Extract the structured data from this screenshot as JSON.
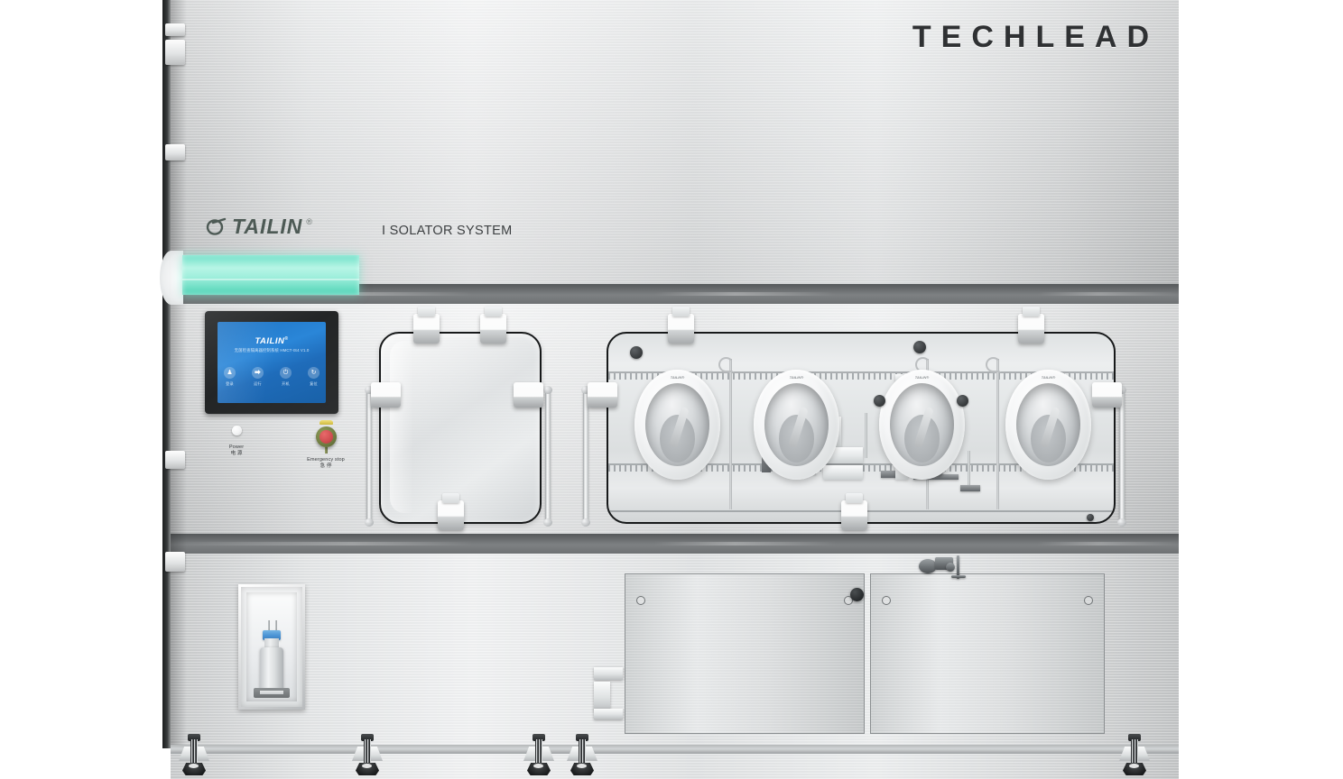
{
  "product": {
    "manufacturer_brand": "TECHLEAD",
    "oem_brand": "TAILIN",
    "registered_mark": "®",
    "system_label": "I SOLATOR SYSTEM"
  },
  "hmi": {
    "logo_text": "TAILIN",
    "logo_mark": "®",
    "subtitle": "无菌检查隔离器控制系统 HMCT-IS4 V1.0",
    "buttons": [
      {
        "label": "登录",
        "icon": "user-icon",
        "glyph": "♟"
      },
      {
        "label": "运行",
        "icon": "export-icon",
        "glyph": "⮕"
      },
      {
        "label": "开机",
        "icon": "power-icon",
        "glyph": "⏻"
      },
      {
        "label": "复位",
        "icon": "reset-icon",
        "glyph": "↻"
      }
    ]
  },
  "controls": {
    "power": {
      "label_en": "Power",
      "label_cn": "电 源",
      "state": "off"
    },
    "emergency_stop": {
      "label_en": "Emergency stop",
      "label_cn": "急 停"
    }
  },
  "status_light": {
    "name": "status-light-bar",
    "color": "#7fe6cf",
    "state": "green"
  },
  "chamber": {
    "glove_ports_count": 4,
    "port_label": "TAILIN®",
    "doors": [
      {
        "name": "left-chamber-door",
        "type": "hinged-viewing-door"
      },
      {
        "name": "main-chamber-door",
        "type": "hinged-viewing-door"
      }
    ]
  },
  "lower_section": {
    "viewing_window": {
      "name": "bottle-viewing-window",
      "contents": "reagent-bottle"
    },
    "access_panels": 2,
    "panel_screws_per_panel": 2
  },
  "colors": {
    "steel_light": "#e8eaeb",
    "steel_mid": "#c9cbcc",
    "band_dark": "#6e7173",
    "accent_green": "#7fe6cf",
    "hmi_blue": "#2a86d8",
    "estop_red": "#cf4d50",
    "text_dark": "#2f3133"
  }
}
